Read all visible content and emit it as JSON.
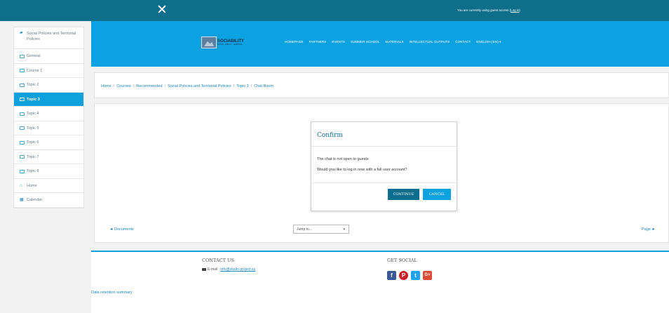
{
  "topbar": {
    "close_symbol": "✕",
    "guest_text": "You are currently using guest access (",
    "login_label": "Log in",
    "guest_text_end": ")"
  },
  "sidebar": {
    "items": [
      {
        "label": "Social Policies and Territorial Policies",
        "icon": "graduation-cap-icon"
      },
      {
        "label": "General",
        "icon": "folder-icon"
      },
      {
        "label": "Course 1",
        "icon": "folder-icon"
      },
      {
        "label": "Topic 2",
        "icon": "folder-icon"
      },
      {
        "label": "Topic 3",
        "icon": "folder-icon",
        "active": true
      },
      {
        "label": "Topic 4",
        "icon": "folder-icon"
      },
      {
        "label": "Topic 5",
        "icon": "folder-icon"
      },
      {
        "label": "Topic 6",
        "icon": "folder-icon"
      },
      {
        "label": "Topic 7",
        "icon": "folder-icon"
      },
      {
        "label": "Topic 8",
        "icon": "folder-icon"
      },
      {
        "label": "Home",
        "icon": "home-icon"
      },
      {
        "label": "Calendar",
        "icon": "calendar-icon"
      }
    ]
  },
  "header": {
    "logo_text": "SOCIABILITY",
    "logo_sub": "SOCIAL · ABILITY · LEARNING",
    "nav": [
      "HOMEPAGE",
      "PARTNERS",
      "EVENTS",
      "SUMMER SCHOOL",
      "MATERIALS",
      "INTELLECTUAL OUTPUTS",
      "CONTACT",
      "ENGLISH (EN) ▾"
    ]
  },
  "breadcrumb": [
    "Home",
    "Courses",
    "Recommended",
    "Social Policies and Territorial Policies",
    "Topic 3",
    "Chat Room"
  ],
  "modal": {
    "title": "Confirm",
    "message1": "The chat is not open to guests",
    "message2": "Would you like to log in now with a full user account?",
    "continue_label": "CONTINUE",
    "cancel_label": "CANCEL"
  },
  "navigation": {
    "prev_label": "◄ Documents",
    "jump_label": "Jump to...",
    "next_label": "Page ►"
  },
  "footer": {
    "contact_title": "CONTACT US",
    "email_prefix": "E-mail : ",
    "email": "info@studio-project.eu",
    "social_title": "GET SOCIAL",
    "social": [
      "f",
      "P",
      "t",
      "G+"
    ],
    "data_retention": "Data retention summary"
  },
  "colors": {
    "topbar": "#0f6f8a",
    "header": "#0ca2e2",
    "active_item": "#0fa0de",
    "link": "#1a86b9"
  }
}
